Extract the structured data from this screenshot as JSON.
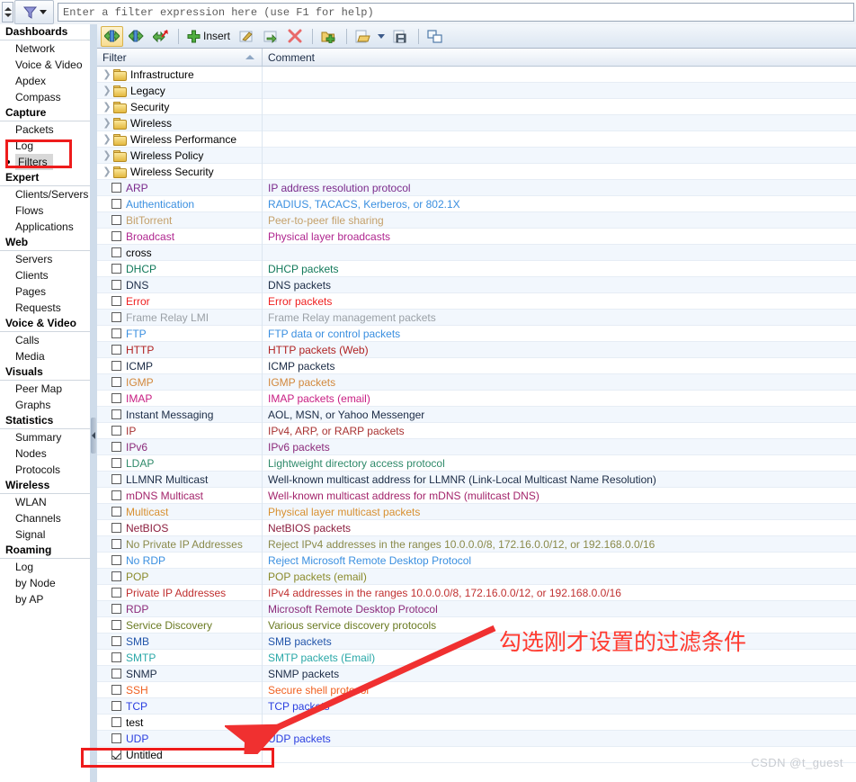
{
  "topbar": {
    "filter_placeholder": "Enter a filter expression here (use F1 for help)",
    "filter_value": "",
    "funnel_icon": "funnel-filter-icon",
    "spinner_icon": "up-down-spinner-icon",
    "dropdown_icon": "chevron-down-icon"
  },
  "sidebar": {
    "groups": [
      {
        "label": "Dashboards",
        "items": [
          {
            "label": "Network",
            "selected": false
          },
          {
            "label": "Voice & Video",
            "selected": false
          },
          {
            "label": "Apdex",
            "selected": false
          },
          {
            "label": "Compass",
            "selected": false
          }
        ]
      },
      {
        "label": "Capture",
        "items": [
          {
            "label": "Packets",
            "selected": false
          },
          {
            "label": "Log",
            "selected": false
          },
          {
            "label": "Filters",
            "selected": true
          }
        ]
      },
      {
        "label": "Expert",
        "items": [
          {
            "label": "Clients/Servers",
            "selected": false
          },
          {
            "label": "Flows",
            "selected": false
          },
          {
            "label": "Applications",
            "selected": false
          }
        ]
      },
      {
        "label": "Web",
        "items": [
          {
            "label": "Servers",
            "selected": false
          },
          {
            "label": "Clients",
            "selected": false
          },
          {
            "label": "Pages",
            "selected": false
          },
          {
            "label": "Requests",
            "selected": false
          }
        ]
      },
      {
        "label": "Voice & Video",
        "items": [
          {
            "label": "Calls",
            "selected": false
          },
          {
            "label": "Media",
            "selected": false
          }
        ]
      },
      {
        "label": "Visuals",
        "items": [
          {
            "label": "Peer Map",
            "selected": false
          },
          {
            "label": "Graphs",
            "selected": false
          }
        ]
      },
      {
        "label": "Statistics",
        "items": [
          {
            "label": "Summary",
            "selected": false
          },
          {
            "label": "Nodes",
            "selected": false
          },
          {
            "label": "Protocols",
            "selected": false
          }
        ]
      },
      {
        "label": "Wireless",
        "items": [
          {
            "label": "WLAN",
            "selected": false
          },
          {
            "label": "Channels",
            "selected": false
          },
          {
            "label": "Signal",
            "selected": false
          }
        ]
      },
      {
        "label": "Roaming",
        "items": [
          {
            "label": "Log",
            "selected": false
          },
          {
            "label": "by Node",
            "selected": false
          },
          {
            "label": "by AP",
            "selected": false
          }
        ]
      }
    ]
  },
  "toolbar": {
    "buttons": [
      {
        "name": "show-all-filters-button",
        "icon": "arrows-both-icon",
        "label": "",
        "active": true
      },
      {
        "name": "show-accepted-filters-button",
        "icon": "arrows-accept-icon",
        "label": "",
        "active": false
      },
      {
        "name": "show-rejected-filters-button",
        "icon": "arrows-reject-icon",
        "label": "",
        "active": false
      },
      {
        "name": "insert-button",
        "icon": "plus-green-icon",
        "label": "Insert",
        "active": false
      },
      {
        "name": "edit-button",
        "icon": "pencil-edit-icon",
        "label": "",
        "active": false
      },
      {
        "name": "duplicate-button",
        "icon": "duplicate-icon",
        "label": "",
        "active": false
      },
      {
        "name": "delete-button",
        "icon": "red-x-icon",
        "label": "",
        "active": false
      },
      {
        "name": "new-folder-button",
        "icon": "folder-add-icon",
        "label": "",
        "active": false
      },
      {
        "name": "open-button",
        "icon": "folder-open-icon",
        "label": "",
        "active": false
      },
      {
        "name": "save-button",
        "icon": "floppy-save-icon",
        "label": "",
        "active": false
      },
      {
        "name": "arrange-button",
        "icon": "tile-windows-icon",
        "label": "",
        "active": false
      }
    ]
  },
  "table": {
    "columns": {
      "filter": "Filter",
      "comment": "Comment"
    },
    "sort": "ascending",
    "folders": [
      {
        "label": "Infrastructure"
      },
      {
        "label": "Legacy"
      },
      {
        "label": "Security"
      },
      {
        "label": "Wireless"
      },
      {
        "label": "Wireless Performance"
      },
      {
        "label": "Wireless Policy"
      },
      {
        "label": "Wireless Security"
      }
    ],
    "rows": [
      {
        "name": "ARP",
        "checked": false,
        "comment": "IP address resolution protocol",
        "color": "#7a2a8c"
      },
      {
        "name": "Authentication",
        "checked": false,
        "comment": "RADIUS, TACACS, Kerberos, or 802.1X",
        "color": "#3a8fe0"
      },
      {
        "name": "BitTorrent",
        "checked": false,
        "comment": "Peer-to-peer file sharing",
        "color": "#c4a06a"
      },
      {
        "name": "Broadcast",
        "checked": false,
        "comment": "Physical layer broadcasts",
        "color": "#b0268f"
      },
      {
        "name": "cross",
        "checked": false,
        "comment": "",
        "color": "#000000"
      },
      {
        "name": "DHCP",
        "checked": false,
        "comment": "DHCP packets",
        "color": "#12795a"
      },
      {
        "name": "DNS",
        "checked": false,
        "comment": "DNS packets",
        "color": "#1b2b45"
      },
      {
        "name": "Error",
        "checked": false,
        "comment": "Error packets",
        "color": "#ef2020"
      },
      {
        "name": "Frame Relay LMI",
        "checked": false,
        "comment": "Frame Relay management packets",
        "color": "#9aa0a6"
      },
      {
        "name": "FTP",
        "checked": false,
        "comment": "FTP data or control packets",
        "color": "#3a8fe0"
      },
      {
        "name": "HTTP",
        "checked": false,
        "comment": "HTTP packets (Web)",
        "color": "#b02222"
      },
      {
        "name": "ICMP",
        "checked": false,
        "comment": "ICMP packets",
        "color": "#1b2b45"
      },
      {
        "name": "IGMP",
        "checked": false,
        "comment": "IGMP packets",
        "color": "#d2883c"
      },
      {
        "name": "IMAP",
        "checked": false,
        "comment": "IMAP packets (email)",
        "color": "#c81e83"
      },
      {
        "name": "Instant Messaging",
        "checked": false,
        "comment": "AOL, MSN, or Yahoo Messenger",
        "color": "#1b2b45"
      },
      {
        "name": "IP",
        "checked": false,
        "comment": "IPv4, ARP, or RARP packets",
        "color": "#a83232"
      },
      {
        "name": "IPv6",
        "checked": false,
        "comment": "IPv6 packets",
        "color": "#8b2a7a"
      },
      {
        "name": "LDAP",
        "checked": false,
        "comment": "Lightweight directory access protocol",
        "color": "#2f8a6a"
      },
      {
        "name": "LLMNR Multicast",
        "checked": false,
        "comment": "Well-known multicast address for LLMNR (Link-Local Multicast Name Resolution)",
        "color": "#1b2b45"
      },
      {
        "name": "mDNS Multicast",
        "checked": false,
        "comment": "Well-known multicast address for mDNS (mulitcast DNS)",
        "color": "#a3246b"
      },
      {
        "name": "Multicast",
        "checked": false,
        "comment": "Physical layer multicast packets",
        "color": "#d89030"
      },
      {
        "name": "NetBIOS",
        "checked": false,
        "comment": "NetBIOS packets",
        "color": "#8c1f3f"
      },
      {
        "name": "No Private IP Addresses",
        "checked": false,
        "comment": "Reject IPv4 addresses in the ranges 10.0.0.0/8, 172.16.0.0/12, or 192.168.0.0/16",
        "color": "#8a8a4a"
      },
      {
        "name": "No RDP",
        "checked": false,
        "comment": "Reject Microsoft Remote Desktop Protocol",
        "color": "#3a8fe0"
      },
      {
        "name": "POP",
        "checked": false,
        "comment": "POP packets (email)",
        "color": "#8a8a2a"
      },
      {
        "name": "Private IP Addresses",
        "checked": false,
        "comment": "IPv4 addresses in the ranges 10.0.0.0/8, 172.16.0.0/12, or 192.168.0.0/16",
        "color": "#c03030"
      },
      {
        "name": "RDP",
        "checked": false,
        "comment": "Microsoft Remote Desktop Protocol",
        "color": "#8b2a7a"
      },
      {
        "name": "Service Discovery",
        "checked": false,
        "comment": "Various service discovery protocols",
        "color": "#6a7a22"
      },
      {
        "name": "SMB",
        "checked": false,
        "comment": "SMB packets",
        "color": "#2255aa"
      },
      {
        "name": "SMTP",
        "checked": false,
        "comment": "SMTP packets (Email)",
        "color": "#2aa8a8"
      },
      {
        "name": "SNMP",
        "checked": false,
        "comment": "SNMP packets",
        "color": "#1b2b45"
      },
      {
        "name": "SSH",
        "checked": false,
        "comment": "Secure shell protocol",
        "color": "#f06020"
      },
      {
        "name": "TCP",
        "checked": false,
        "comment": "TCP packets",
        "color": "#2a3ee0"
      },
      {
        "name": "test",
        "checked": false,
        "comment": "",
        "color": "#000000"
      },
      {
        "name": "UDP",
        "checked": false,
        "comment": "UDP packets",
        "color": "#2a3ee0"
      },
      {
        "name": "Untitled",
        "checked": true,
        "comment": "",
        "color": "#000000"
      }
    ]
  },
  "annotations": {
    "callout_text": "勾选刚才设置的过滤条件",
    "accent_color": "#ee1c1c",
    "watermark": "CSDN @t_guest"
  }
}
